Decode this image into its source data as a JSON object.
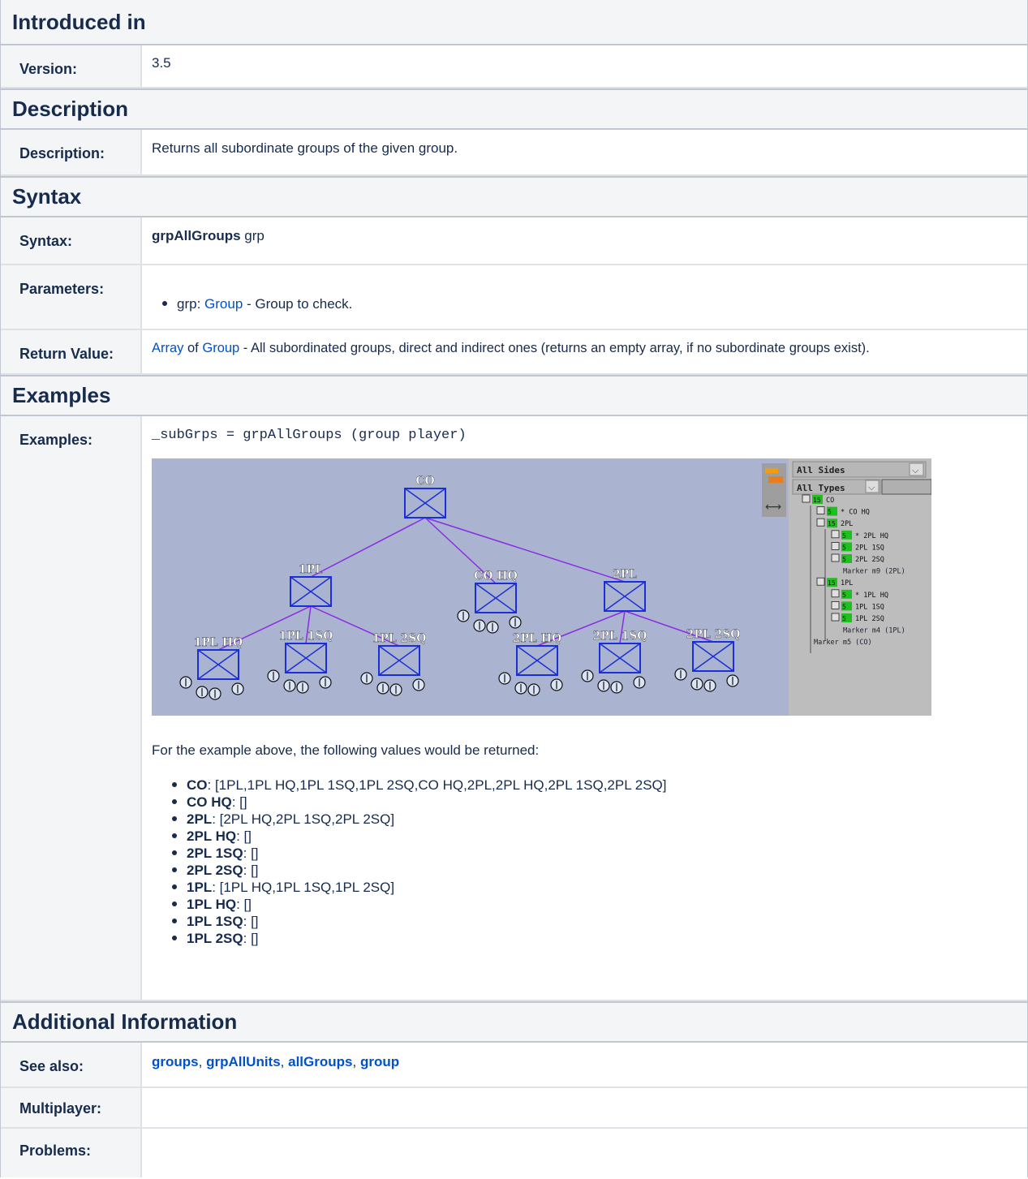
{
  "sections": {
    "introduced": "Introduced in",
    "description": "Description",
    "syntax": "Syntax",
    "examples": "Examples",
    "additional": "Additional Information"
  },
  "labels": {
    "version": "Version:",
    "description": "Description:",
    "syntax": "Syntax:",
    "parameters": "Parameters:",
    "return_value": "Return Value:",
    "examples": "Examples:",
    "see_also": "See also:",
    "multiplayer": "Multiplayer:",
    "problems": "Problems:"
  },
  "version": "3.5",
  "description": "Returns all subordinate groups of the given group.",
  "syntax": {
    "command": "grpAllGroups",
    "arg": " grp"
  },
  "parameter": {
    "prefix": "grp: ",
    "type_link": "Group",
    "rest": " - Group to check."
  },
  "return_value": {
    "link1": "Array",
    "mid": " of ",
    "link2": "Group",
    "rest": " - All subordinated groups, direct and indirect ones (returns an empty array, if no subordinate groups exist)."
  },
  "example_code": "_subGrps = grpAllGroups (group player)",
  "example_intro": "For the example above, the following values would be returned:",
  "results": [
    {
      "name": "CO",
      "value": ": [1PL,1PL HQ,1PL 1SQ,1PL 2SQ,CO HQ,2PL,2PL HQ,2PL 1SQ,2PL 2SQ]"
    },
    {
      "name": "CO HQ",
      "value": ": []"
    },
    {
      "name": "2PL",
      "value": ": [2PL HQ,2PL 1SQ,2PL 2SQ]"
    },
    {
      "name": "2PL HQ",
      "value": ": []"
    },
    {
      "name": "2PL 1SQ",
      "value": ": []"
    },
    {
      "name": "2PL 2SQ",
      "value": ": []"
    },
    {
      "name": "1PL",
      "value": ": [1PL HQ,1PL 1SQ,1PL 2SQ]"
    },
    {
      "name": "1PL HQ",
      "value": ": []"
    },
    {
      "name": "1PL 1SQ",
      "value": ": []"
    },
    {
      "name": "1PL 2SQ",
      "value": ": []"
    }
  ],
  "see_also": [
    "groups",
    "grpAllUnits",
    "allGroups",
    "group"
  ],
  "figure": {
    "nodes": [
      {
        "label": "CO"
      },
      {
        "label": "1PL"
      },
      {
        "label": "CO HQ"
      },
      {
        "label": "2PL"
      },
      {
        "label": "1PL HQ"
      },
      {
        "label": "1PL 1SQ"
      },
      {
        "label": "1PL 2SQ"
      },
      {
        "label": "2PL HQ"
      },
      {
        "label": "2PL 1SQ"
      },
      {
        "label": "2PL 2SQ"
      }
    ],
    "side_filter": "All Sides",
    "type_filter": "All Types",
    "tree": [
      {
        "count": "15",
        "text": "CO"
      },
      {
        "count": "5",
        "text": "* CO HQ"
      },
      {
        "count": "15",
        "text": "2PL"
      },
      {
        "count": "5",
        "text": "* 2PL HQ"
      },
      {
        "count": "5",
        "text": "2PL 1SQ"
      },
      {
        "count": "5",
        "text": "2PL 2SQ"
      },
      {
        "count": "",
        "text": "Marker m9 (2PL)"
      },
      {
        "count": "15",
        "text": "1PL"
      },
      {
        "count": "5",
        "text": "* 1PL HQ"
      },
      {
        "count": "5",
        "text": "1PL 1SQ"
      },
      {
        "count": "5",
        "text": "1PL 2SQ"
      },
      {
        "count": "",
        "text": "Marker m4 (1PL)"
      },
      {
        "count": "",
        "text": "Marker m5 (CO)"
      }
    ],
    "colors": {
      "map_bg": "#aab4d0",
      "panel_bg": "#bdbdbd",
      "link": "#8a2be2",
      "box": "#1b2fd6",
      "count_bg": "#1fbf1f"
    }
  }
}
